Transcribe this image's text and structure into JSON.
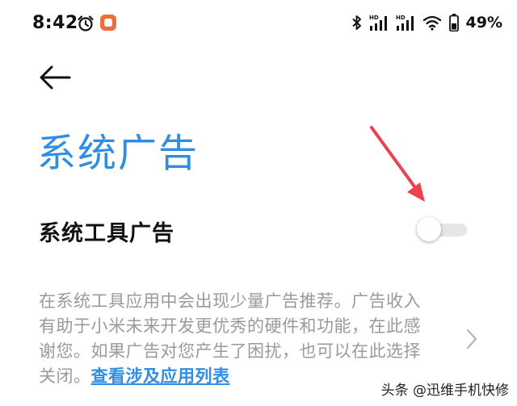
{
  "status_bar": {
    "time": "8:42",
    "battery_percent": "49%",
    "icons": [
      "alarm-clock-icon",
      "app-notification-icon",
      "bluetooth-icon",
      "hd-signal-icon",
      "hd-signal-icon",
      "wifi-icon",
      "battery-icon"
    ]
  },
  "header": {
    "back_icon": "arrow-left-icon",
    "title": "系统广告"
  },
  "setting": {
    "label": "系统工具广告",
    "toggle_on": false
  },
  "description": {
    "text": "在系统工具应用中会出现少量广告推荐。广告收入有助于小米未来开发更优秀的硬件和功能，在此感谢您。如果广告对您产生了困扰，也可以在此选择关闭。",
    "link_text": "查看涉及应用列表"
  },
  "watermark": "头条 @迅维手机快修",
  "colors": {
    "accent": "#2f8de4",
    "annotation": "#e8434f",
    "description_text": "#9a9a9a"
  }
}
